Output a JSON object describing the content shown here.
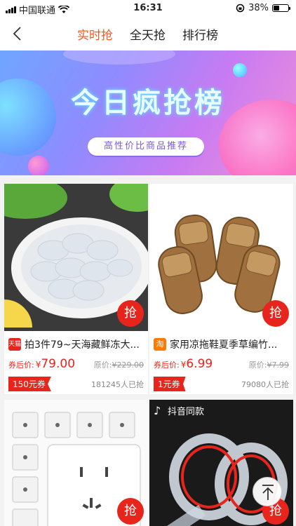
{
  "status_bar": {
    "carrier": "中国联通",
    "time": "16:31",
    "battery_percent": "38%",
    "battery_level": 0.38
  },
  "nav": {
    "tabs": [
      {
        "label": "实时抢",
        "active": true
      },
      {
        "label": "全天抢"
      },
      {
        "label": "排行榜"
      }
    ]
  },
  "banner": {
    "title": "今日疯抢榜",
    "subtitle": "高性价比商品推荐"
  },
  "products": [
    {
      "shop": "天猫",
      "title": "拍3件79~天海藏鲜冻大...",
      "coupon_price_label": "券后价:",
      "currency": "¥",
      "price": "79.00",
      "orig_label": "原价:",
      "orig_price": "¥229.00",
      "coupon": "150元券",
      "sold": "181245人已抢",
      "grab": "抢"
    },
    {
      "shop": "淘",
      "title": "家用凉拖鞋夏季草编竹...",
      "coupon_price_label": "券后价:",
      "currency": "¥",
      "price": "6.99",
      "orig_label": "原价:",
      "orig_price": "¥7.99",
      "coupon": "1元券",
      "sold": "79080人已抢",
      "grab": "抢"
    },
    {
      "grab": "抢"
    },
    {
      "tag": "抖音同款",
      "grab": "抢"
    }
  ],
  "colors": {
    "accent": "#f15a24",
    "price_red": "#e8251c"
  }
}
